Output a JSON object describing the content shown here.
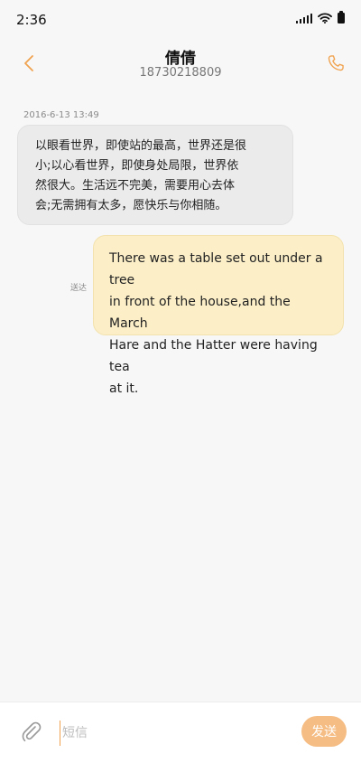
{
  "status_bar": {
    "time": "2:36",
    "icons": [
      "signal-icon",
      "wifi-icon",
      "battery-icon"
    ]
  },
  "header": {
    "contact_name": "倩倩",
    "contact_number": "18730218809",
    "back_icon": "chevron-left-icon",
    "call_icon": "phone-icon",
    "accent_color": "#f0a24e"
  },
  "conversation": {
    "timestamp": "2016-6-13 13:49",
    "incoming": {
      "lines": [
        "以眼看世界，即使站的最高，世界还是很",
        "小;以心看世界，即使身处局限，世界依",
        "然很大。生活远不完美，需要用心去体",
        "会;无需拥有太多，愿快乐与你相随。"
      ],
      "bubble_color": "#ebebeb"
    },
    "outgoing": {
      "lines": [
        "There was a table set out under a tree",
        "in front of the house,and the March",
        "Hare and the Hatter were having tea",
        "at it."
      ],
      "status": "送达",
      "bubble_color": "#fcefc8"
    }
  },
  "input_bar": {
    "attach_icon": "paperclip-icon",
    "placeholder": "短信",
    "value": "",
    "send_label": "发送",
    "send_color": "#f5bd84"
  }
}
